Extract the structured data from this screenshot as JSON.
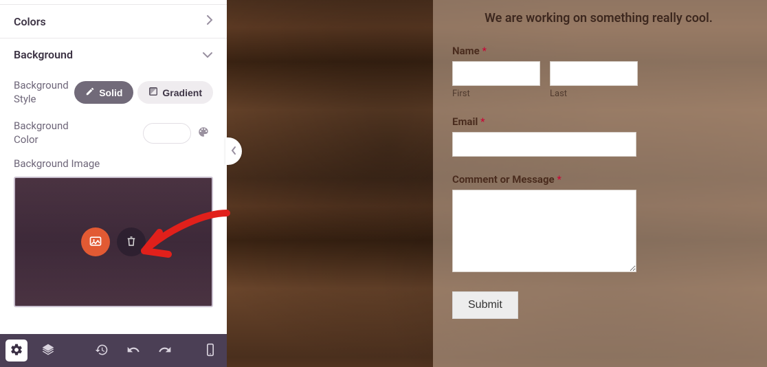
{
  "sidebar": {
    "sections": {
      "colors": {
        "title": "Colors"
      },
      "background": {
        "title": "Background"
      }
    },
    "background": {
      "style_label": "Background Style",
      "solid_label": "Solid",
      "gradient_label": "Gradient",
      "color_label": "Background Color",
      "color_value": "#ffffff",
      "image_label": "Background Image"
    },
    "toolbar_icons": [
      "settings",
      "layers",
      "history",
      "undo",
      "redo",
      "device"
    ]
  },
  "form": {
    "tagline": "We are working on something really cool.",
    "name_label": "Name",
    "first_label": "First",
    "last_label": "Last",
    "email_label": "Email",
    "comment_label": "Comment or Message",
    "submit_label": "Submit",
    "required_marker": "*"
  }
}
